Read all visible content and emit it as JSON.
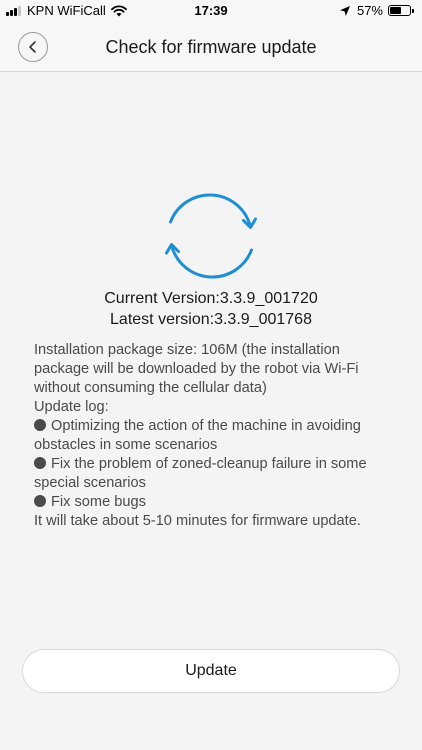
{
  "status_bar": {
    "carrier": "KPN WiFiCall",
    "time": "17:39",
    "battery_percent_label": "57%",
    "battery_level": 0.57,
    "signal_bars": 4,
    "signal_bars_filled": 3
  },
  "nav": {
    "title": "Check for firmware update"
  },
  "versions": {
    "current": "Current Version:3.3.9_001720",
    "latest": "Latest version:3.3.9_001768"
  },
  "details": {
    "package_size": "Installation package size: 106M (the installation package will be downloaded by the robot via Wi-Fi without consuming the cellular data)",
    "log_header": "Update log:",
    "log_items": [
      "Optimizing the action of the machine in avoiding obstacles in some scenarios",
      "Fix the problem of zoned-cleanup failure in some special scenarios",
      "Fix some bugs"
    ],
    "duration_note": "It will take about 5-10 minutes for firmware update."
  },
  "update_button": {
    "label": "Update"
  },
  "colors": {
    "accent": "#1f8fd4",
    "background": "#f4f4f4",
    "text": "#1a1a1a",
    "secondary_text": "#4a4a4a"
  },
  "icons": {
    "back": "chevron-left-icon",
    "refresh": "refresh-icon",
    "wifi": "wifi-icon",
    "location": "location-arrow-icon",
    "battery": "battery-icon"
  }
}
